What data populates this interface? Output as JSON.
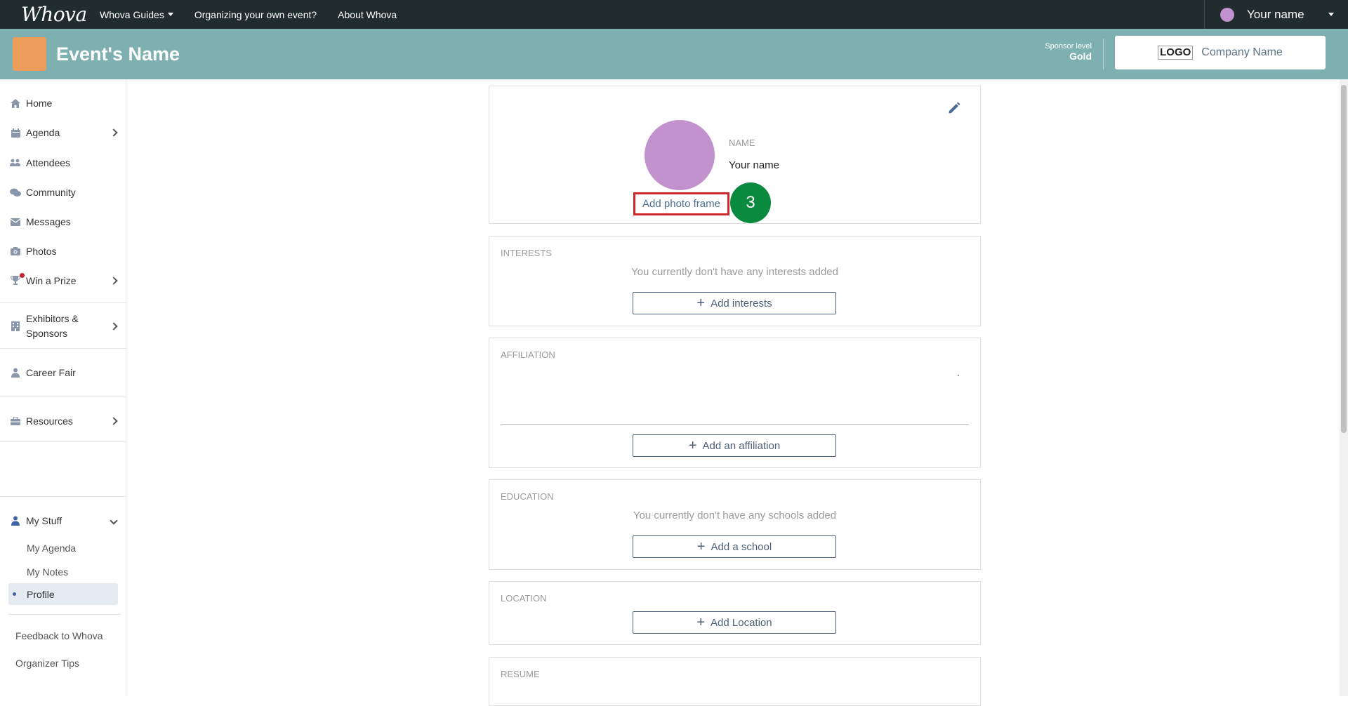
{
  "topbar": {
    "brand": "Whova",
    "nav": [
      {
        "label": "Whova Guides",
        "dropdown": true
      },
      {
        "label": "Organizing your own event?",
        "dropdown": false
      },
      {
        "label": "About Whova",
        "dropdown": false
      }
    ],
    "user_name": "Your name"
  },
  "banner": {
    "event_name": "Event's Name",
    "sponsor_label": "Sponsor level",
    "sponsor_level": "Gold",
    "company_logo": "LOGO",
    "company_name": "Company Name"
  },
  "sidebar": {
    "items": [
      {
        "label": "Home",
        "icon": "home-icon"
      },
      {
        "label": "Agenda",
        "icon": "calendar-icon"
      },
      {
        "label": "Attendees",
        "icon": "users-icon"
      },
      {
        "label": "Community",
        "icon": "chat-icon"
      },
      {
        "label": "Messages",
        "icon": "envelope-icon"
      },
      {
        "label": "Photos",
        "icon": "camera-icon"
      },
      {
        "label": "Win a Prize",
        "icon": "trophy-icon"
      },
      {
        "label": "Exhibitors &",
        "label2": "Sponsors",
        "icon": "building-icon"
      },
      {
        "label": "Career Fair",
        "icon": "person-icon"
      },
      {
        "label": "Resources",
        "icon": "briefcase-icon"
      },
      {
        "label": "My Stuff",
        "icon": "user-icon"
      }
    ],
    "sub_items": [
      {
        "label": "My Agenda"
      },
      {
        "label": "My Notes"
      },
      {
        "label": "Profile",
        "active": true
      }
    ],
    "footer": [
      {
        "label": "Feedback to Whova"
      },
      {
        "label": "Organizer Tips"
      }
    ]
  },
  "profile": {
    "name_label": "NAME",
    "name_value": "Your name",
    "add_photo_frame": "Add photo frame",
    "step_number": "3"
  },
  "sections": {
    "interests": {
      "title": "INTERESTS",
      "empty": "You currently don't have any interests added",
      "button": "Add interests"
    },
    "affiliation": {
      "title": "AFFILIATION",
      "button": "Add an affiliation"
    },
    "education": {
      "title": "EDUCATION",
      "empty": "You currently don't have any schools added",
      "button": "Add a school"
    },
    "location": {
      "title": "LOCATION",
      "button": "Add Location"
    },
    "resume": {
      "title": "RESUME"
    }
  },
  "colors": {
    "topbar": "#212c2e",
    "banner": "#7eb0b1",
    "event_logo": "#ec9d5a",
    "avatar": "#c292ce",
    "step_badge": "#0a8a3e",
    "highlight": "#d0262c",
    "button": "#4b5f78"
  }
}
